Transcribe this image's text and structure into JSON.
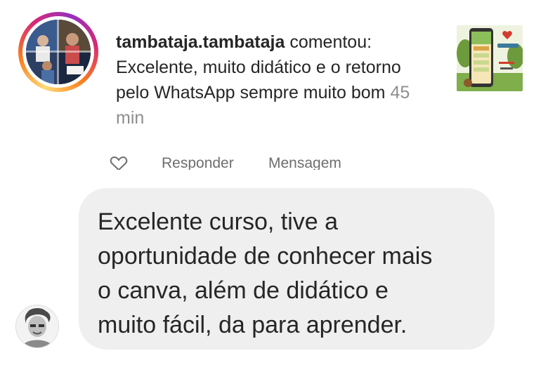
{
  "comment": {
    "username": "tambataja.tambataja",
    "verb": "comentou:",
    "text": "Excelente, muito didático e o retorno pelo WhatsApp sempre muito bom",
    "time": "45 min"
  },
  "actions": {
    "like_icon": "heart-outline-icon",
    "reply_label": "Responder",
    "message_label": "Mensagem"
  },
  "reply_bubble": {
    "lines": [
      "Excelente curso,  tive a",
      "oportunidade de conhecer mais",
      "o canva, além de didático e",
      "muito fácil, da para aprender."
    ]
  },
  "colors": {
    "text": "#262626",
    "muted": "#8e8e8e",
    "bubble": "#efefef",
    "story_ring": [
      "#feda75",
      "#fa7e1e",
      "#d62976",
      "#962fbf"
    ]
  }
}
